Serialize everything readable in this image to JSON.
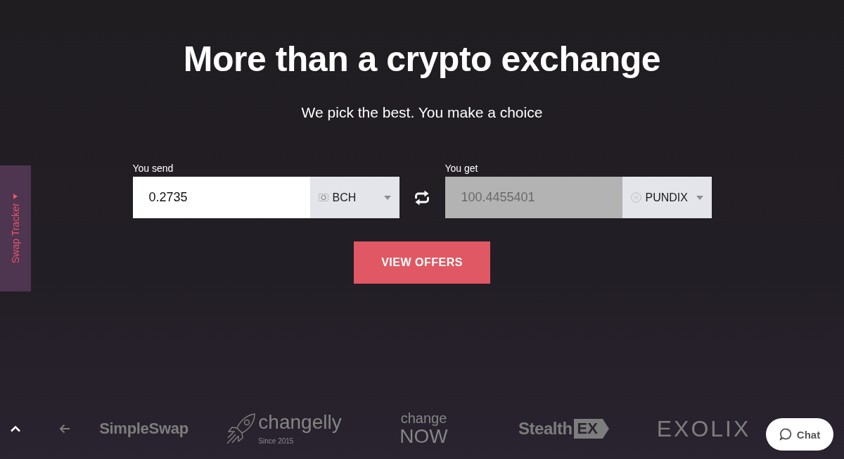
{
  "hero": {
    "title": "More than a crypto exchange",
    "subtitle": "We pick the best. You make a choice"
  },
  "swap_tracker": {
    "label": "Swap Tracker"
  },
  "exchange_form": {
    "send": {
      "label": "You send",
      "value": "0.2735",
      "currency": "BCH",
      "disabled": false
    },
    "get": {
      "label": "You get",
      "value": "100.4455401",
      "currency": "PUNDIX",
      "disabled": true
    },
    "submit": "VIEW OFFERS"
  },
  "partners": [
    {
      "kind": "wordmark",
      "name": "SimpleSwap"
    },
    {
      "kind": "rocket",
      "name": "changelly",
      "tagline": "Since 2015"
    },
    {
      "kind": "stacked",
      "lines": [
        "change",
        "NOW"
      ]
    },
    {
      "kind": "tagged",
      "name": "Stealth",
      "tag": "EX"
    },
    {
      "kind": "wide",
      "name": "EXOLIX"
    }
  ],
  "chat_button": {
    "label": "Chat"
  }
}
